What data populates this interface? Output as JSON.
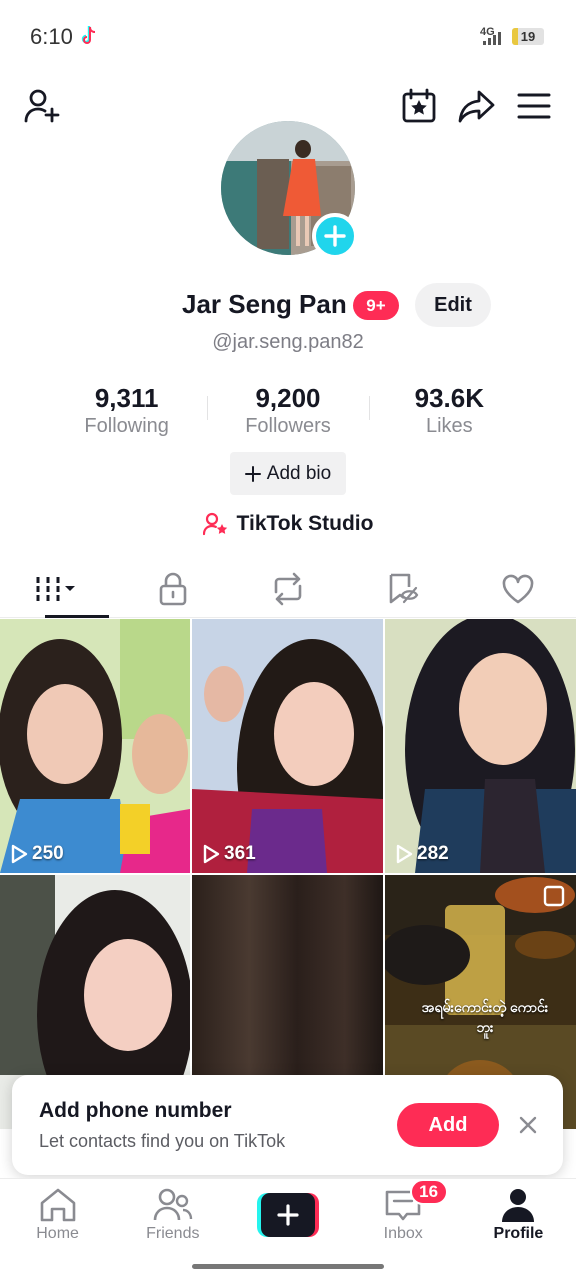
{
  "status_bar": {
    "time": "6:10",
    "network": "4G",
    "battery": "19",
    "battery_level": 0.19
  },
  "profile": {
    "name": "Jar Seng Pan",
    "badge": "9+",
    "edit_label": "Edit",
    "handle": "@jar.seng.pan82",
    "stats": [
      {
        "value": "9,311",
        "label": "Following"
      },
      {
        "value": "9,200",
        "label": "Followers"
      },
      {
        "value": "93.6K",
        "label": "Likes"
      }
    ],
    "add_bio_label": "Add bio",
    "studio_label": "TikTok Studio"
  },
  "tabs": [
    {
      "icon": "videos-grid-icon",
      "active": true
    },
    {
      "icon": "lock-icon",
      "active": false
    },
    {
      "icon": "repost-icon",
      "active": false
    },
    {
      "icon": "bookmark-hidden-icon",
      "active": false
    },
    {
      "icon": "heart-icon",
      "active": false
    }
  ],
  "videos": [
    {
      "views": "250"
    },
    {
      "views": "361"
    },
    {
      "views": "282"
    },
    {
      "views": ""
    },
    {
      "views": ""
    },
    {
      "views": "",
      "overlay_text": "အရမ်းကောင်းတဲ့ ကောင်းဘူး"
    }
  ],
  "popup": {
    "title": "Add phone number",
    "subtitle": "Let contacts find you on TikTok",
    "add_label": "Add"
  },
  "nav": {
    "home": "Home",
    "friends": "Friends",
    "inbox": "Inbox",
    "inbox_badge": "16",
    "profile": "Profile"
  },
  "colors": {
    "accent": "#fe2c55",
    "cyan": "#20d5ec",
    "text": "#161823"
  }
}
